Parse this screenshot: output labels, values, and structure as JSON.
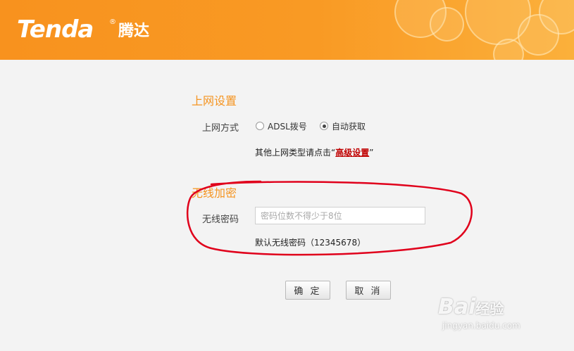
{
  "header": {
    "logo_text": "Tenda",
    "logo_reg": "®",
    "logo_cn": "腾达",
    "bg_color": "#f8921e"
  },
  "internet": {
    "title": "上网设置",
    "mode_label": "上网方式",
    "options": [
      {
        "label": "ADSL拨号",
        "checked": false
      },
      {
        "label": "自动获取",
        "checked": true
      }
    ],
    "hint_prefix": "其他上网类型请点击“",
    "hint_link": "高级设置",
    "hint_suffix": "”"
  },
  "wireless": {
    "title": "无线加密",
    "password_label": "无线密码",
    "password_placeholder": "密码位数不得少于8位",
    "password_value": "",
    "default_hint": "默认无线密码（12345678）"
  },
  "buttons": {
    "confirm": "确 定",
    "cancel": "取 消"
  },
  "watermark": {
    "brand": "Bai",
    "brand_cn": "经验",
    "url": "jingyan.baidu.com"
  },
  "colors": {
    "accent": "#f59420",
    "link": "#c00000",
    "annotation": "#e0001b"
  }
}
